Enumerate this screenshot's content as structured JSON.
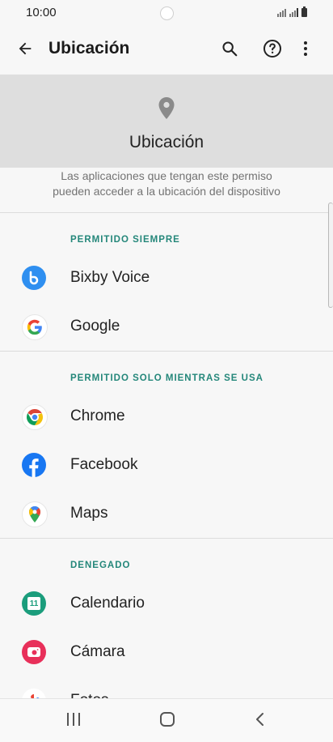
{
  "status_bar": {
    "time": "10:00"
  },
  "app_bar": {
    "title": "Ubicación"
  },
  "header": {
    "title": "Ubicación"
  },
  "description_lines": [
    "Las aplicaciones que tengan este permiso",
    "pueden acceder a la ubicación del dispositivo"
  ],
  "sections": [
    {
      "title": "PERMITIDO SIEMPRE",
      "apps": [
        {
          "label": "Bixby Voice",
          "icon": "bixby-voice-icon"
        },
        {
          "label": "Google",
          "icon": "google-icon"
        }
      ]
    },
    {
      "title": "PERMITIDO SOLO MIENTRAS SE USA",
      "apps": [
        {
          "label": "Chrome",
          "icon": "chrome-icon"
        },
        {
          "label": "Facebook",
          "icon": "facebook-icon"
        },
        {
          "label": "Maps",
          "icon": "maps-icon"
        }
      ]
    },
    {
      "title": "DENEGADO",
      "apps": [
        {
          "label": "Calendario",
          "icon": "calendar-icon",
          "icon_text": "11"
        },
        {
          "label": "Cámara",
          "icon": "camera-icon"
        },
        {
          "label": "Fotos",
          "icon": "photos-icon"
        }
      ]
    }
  ],
  "colors": {
    "section_title": "#24877a",
    "header_background": "#dedede",
    "bixby": "#2f8ff0",
    "facebook": "#1877f2",
    "calendar": "#1b9d7c",
    "camera": "#e8305a"
  }
}
